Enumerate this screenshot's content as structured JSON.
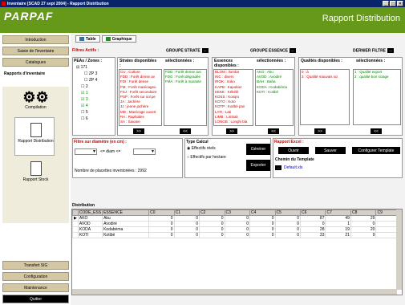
{
  "window": {
    "title": "Inventaire [SCAD 27 sept 2004] - Rapport Distribution",
    "buttons": [
      "_",
      "□",
      "×"
    ]
  },
  "app": {
    "logo": "PARPAF",
    "page_title": "Rapport Distribution"
  },
  "sidebar": {
    "items": [
      {
        "label": "Introduction"
      },
      {
        "label": "Saisie de l'inventaire"
      },
      {
        "label": "Catalogues"
      },
      {
        "label": "Rapports d'inventaire"
      }
    ],
    "tools": [
      {
        "label": "Compilation"
      },
      {
        "label": "Rapport Distribution"
      },
      {
        "label": "Rapport Stock"
      }
    ],
    "bottom": [
      {
        "label": "Transfert SIG"
      },
      {
        "label": "Configuration"
      },
      {
        "label": "Maintenance"
      },
      {
        "label": "Quitter"
      }
    ]
  },
  "tabs": [
    {
      "label": "Table"
    },
    {
      "label": "Graphique"
    }
  ],
  "filters": {
    "label": "Filtres Actifs :",
    "groupe_strate": "GROUPE STRATE",
    "groupe_essence": "GROUPE ESSENCE",
    "dernier_filtre": "DERNIER FILTRE",
    "dots": "...",
    "peas": {
      "title": "PEAs / Zones :",
      "tree": [
        "171",
        "ZP 3",
        "ZP 4",
        "2",
        "1",
        "3",
        "4",
        "5",
        "6"
      ]
    },
    "strates": {
      "title": "Strates disponibles :",
      "available": [
        "CU : Culture",
        "FDD : Forêt dense av",
        "FDI : Forêt dense",
        "FM : Forêt marécageu",
        "FSJ : Forêt secondaire",
        "PSP : Forêt sur sol pe",
        "JA : Jachère",
        "JJ : jeune jachère",
        "MD : Marécage ouvert",
        "RA : Raphiales",
        "SA : Savane"
      ],
      "sel_title": "sélectionnées :",
      "selected": [
        "FDD : Forêt dense avc",
        "FDG : Forêt dégradée",
        "FMA : Forêt à marantir"
      ]
    },
    "essences": {
      "title": "Essences disponibles :",
      "available": [
        "BLOM : Ilomba",
        "INC : divers",
        "IROK : Iroko",
        "KAPB : Kapokier",
        "KEKE : Kékélé",
        "KOSS : Kosipo",
        "KOTO : Koto",
        "KOTP : Kotibé pan",
        "LATI : Lati",
        "LIMB : Limbali",
        "LONGB : Longhi bla"
      ],
      "sel_title": "sélectionnées :",
      "selected": [
        "AKO : Aku",
        "AVOD : Avodiré",
        "BAH : Baha",
        "KODA : Kodabéma",
        "KOTI : Kotibé"
      ]
    },
    "qualites": {
      "title": "Qualités disponibles :",
      "available": [
        "0 : à",
        "3 : Qualité mauvais sci"
      ],
      "sel_title": "sélectionnées :",
      "selected": [
        "1 : Qualité export",
        "2 : qualité bon sciage"
      ]
    },
    "arrows_add": ">>",
    "arrows_remove": "<<"
  },
  "diam": {
    "title": "Filtre sur diamètre (en cm) :",
    "op": "<= diam <=",
    "count_label": "Nombre de placettes inventoriées :",
    "count": "2992"
  },
  "calc": {
    "title": "Type Calcul",
    "opt1": "Effectifs réels",
    "opt2": "Effectifs par hectare",
    "generate": "Générer",
    "export": "Exporter"
  },
  "excel": {
    "title": "Rapport Excel :",
    "open": "Ouvrir",
    "save": "Sauver",
    "config": "Configurer Template",
    "chemin": "Chemin du Template",
    "path": "Default.xls"
  },
  "grid": {
    "title": "Distribution",
    "columns": [
      "",
      "CODE_ESS",
      "ESSENCE",
      "C0",
      "C1",
      "C2",
      "C3",
      "C4",
      "C5",
      "C6",
      "C7",
      "C8",
      "C9"
    ],
    "rows": [
      [
        "▶",
        "AKO",
        "Aku",
        "0",
        "0",
        "0",
        "0",
        "0",
        "0",
        "87",
        "49",
        "29",
        ""
      ],
      [
        "",
        "AVOD",
        "Avodiré",
        "0",
        "0",
        "0",
        "0",
        "0",
        "0",
        "0",
        "1",
        "0",
        ""
      ],
      [
        "",
        "KODA",
        "Kodabéma",
        "0",
        "0",
        "0",
        "0",
        "0",
        "0",
        "28",
        "19",
        "20",
        ""
      ],
      [
        "",
        "KOTI",
        "Kotibé",
        "0",
        "0",
        "0",
        "0",
        "0",
        "0",
        "33",
        "21",
        "9",
        ""
      ]
    ]
  }
}
